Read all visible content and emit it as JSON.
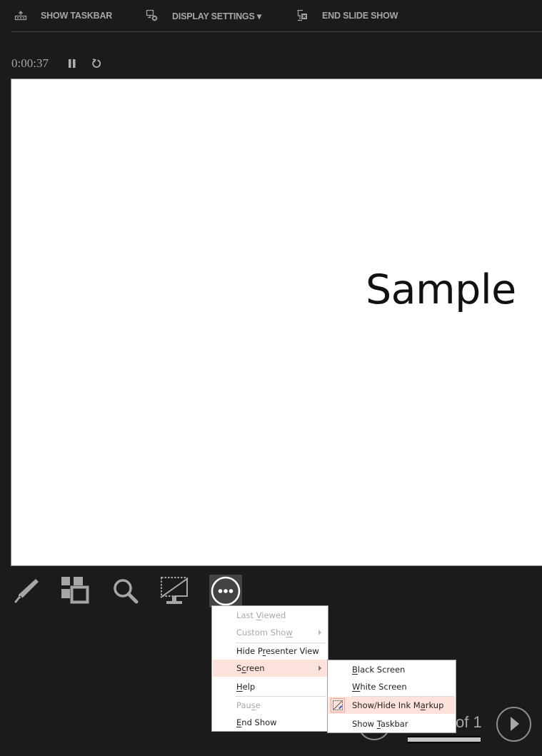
{
  "toolbar": {
    "show_taskbar": {
      "label": "SHOW TASKBAR",
      "icon": "taskbar-up-icon"
    },
    "display_settings": {
      "label": "DISPLAY SETTINGS ▾",
      "icon": "display-gear-icon"
    },
    "end_slide_show": {
      "label": "END SLIDE SHOW",
      "icon": "end-show-icon"
    }
  },
  "timer": {
    "elapsed": "0:00:37",
    "pause_icon": "pause-icon",
    "reset_icon": "reset-icon"
  },
  "slide": {
    "text": "Sample"
  },
  "tools": [
    {
      "name": "pen-tool",
      "icon": "pen-icon"
    },
    {
      "name": "see-all-slides",
      "icon": "slides-grid-icon"
    },
    {
      "name": "zoom-into-slide",
      "icon": "magnifier-icon"
    },
    {
      "name": "black-screen",
      "icon": "screen-slash-icon"
    },
    {
      "name": "more-options",
      "icon": "ellipsis-icon",
      "active": true
    }
  ],
  "navigation": {
    "slide_counter": "of 1",
    "progress": 1.0
  },
  "context_menu": {
    "items": [
      {
        "pre": "Last ",
        "u": "V",
        "post": "iewed",
        "disabled": true
      },
      {
        "pre": "Custom Sho",
        "u": "w",
        "post": "",
        "disabled": true,
        "submenu": true
      },
      {
        "pre": "Hide P",
        "u": "r",
        "post": "esenter View"
      },
      {
        "pre": "S",
        "u": "c",
        "post": "reen",
        "submenu": true,
        "highlighted": true
      },
      {
        "pre": "",
        "u": "H",
        "post": "elp"
      },
      {
        "pre": "Pau",
        "u": "s",
        "post": "e",
        "disabled": true
      },
      {
        "pre": "",
        "u": "E",
        "post": "nd Show"
      }
    ]
  },
  "screen_submenu": {
    "items": [
      {
        "pre": "",
        "u": "B",
        "post": "lack Screen"
      },
      {
        "pre": "",
        "u": "W",
        "post": "hite Screen"
      },
      {
        "pre": "Show/Hide Ink M",
        "u": "a",
        "post": "rkup",
        "highlighted": true,
        "checked": true,
        "icon": "ink-markup-icon"
      },
      {
        "pre": "Show ",
        "u": "T",
        "post": "askbar"
      }
    ]
  },
  "colors": {
    "background": "#1b1b1b",
    "menu_highlight": "#fde3db",
    "toolbar_text": "#a6a6a6"
  }
}
